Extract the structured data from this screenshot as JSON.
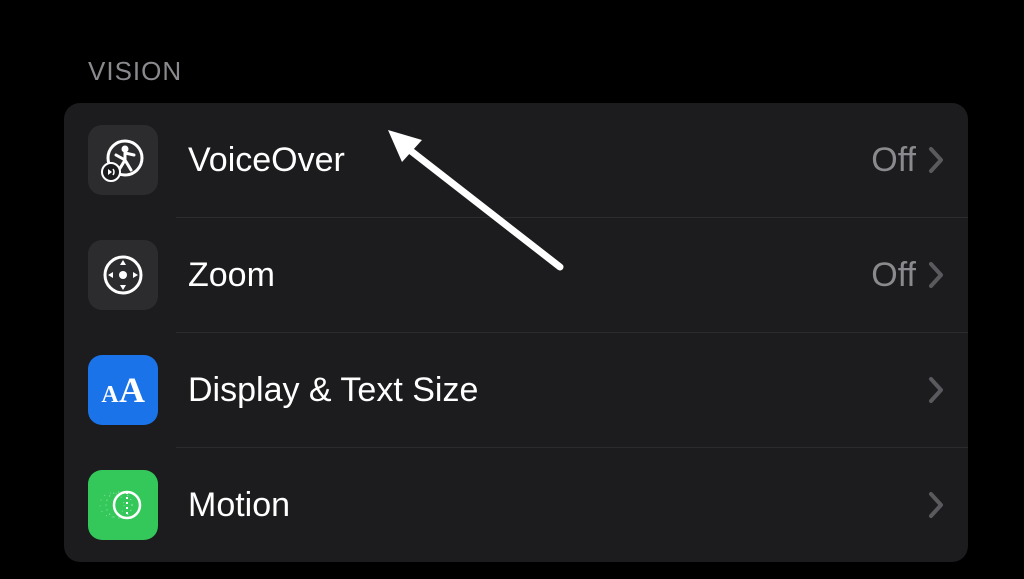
{
  "section": {
    "header": "VISION"
  },
  "rows": [
    {
      "icon": "voiceover",
      "label": "VoiceOver",
      "status": "Off"
    },
    {
      "icon": "zoom",
      "label": "Zoom",
      "status": "Off"
    },
    {
      "icon": "textsize",
      "label": "Display & Text Size",
      "status": ""
    },
    {
      "icon": "motion",
      "label": "Motion",
      "status": ""
    }
  ]
}
